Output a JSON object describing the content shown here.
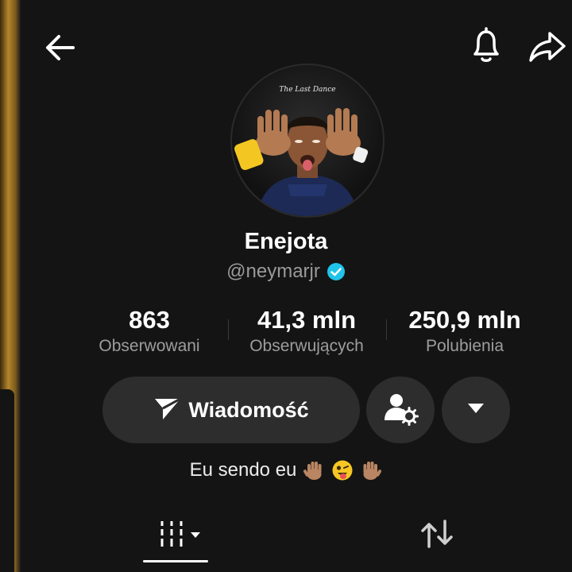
{
  "header": {
    "back_icon": "arrow-left-icon",
    "bell_icon": "bell-icon",
    "share_icon": "share-icon"
  },
  "profile": {
    "avatar_caption": "The Last Dance",
    "display_name": "Enejota",
    "handle": "@neymarjr",
    "verified": true,
    "verified_color": "#20c4e8"
  },
  "stats": [
    {
      "value": "863",
      "label": "Obserwowani"
    },
    {
      "value": "41,3 mln",
      "label": "Obserwujących"
    },
    {
      "value": "250,9 mln",
      "label": "Polubienia"
    }
  ],
  "actions": {
    "message_label": "Wiadomość",
    "message_icon": "paper-plane-icon",
    "add_friend_icon": "user-settings-icon",
    "more_icon": "caret-down-icon"
  },
  "bio": {
    "text": "Eu sendo eu",
    "emojis": [
      "raised-hand",
      "winking-face-with-tongue",
      "raised-hand"
    ]
  },
  "tabs": [
    {
      "name": "videos",
      "icon": "grid-columns-icon",
      "active": true
    },
    {
      "name": "reposts",
      "icon": "repost-icon",
      "active": false
    }
  ]
}
